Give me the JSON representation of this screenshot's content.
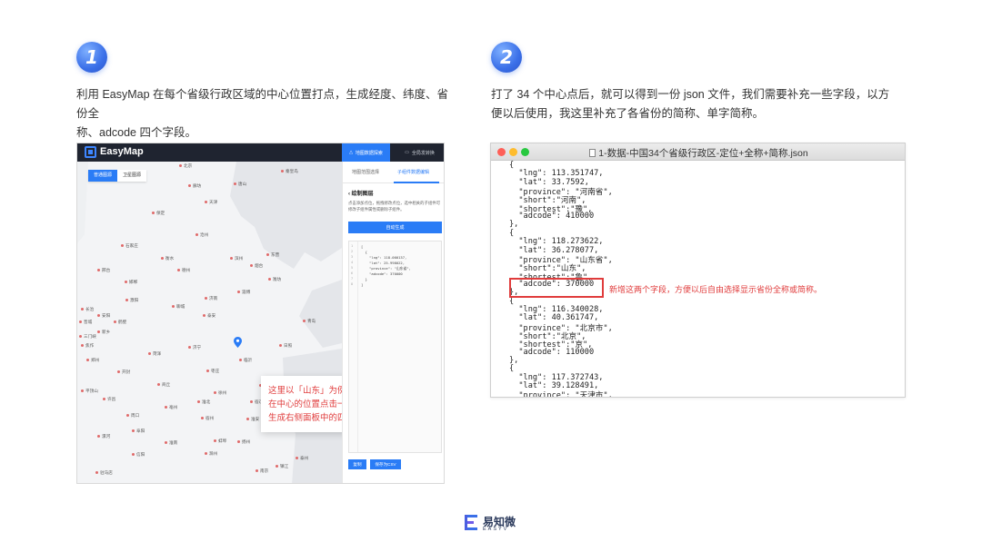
{
  "steps": [
    {
      "number": "1",
      "text_line1": "利用 EasyMap 在每个省级行政区域的中心位置打点，生成经度、纬度、省份全",
      "text_line2": "称、adcode 四个字段。"
    },
    {
      "number": "2",
      "text_line1": "打了 34 个中心点后，就可以得到一份 json 文件，我们需要补充一些字段，以方",
      "text_line2": "便以后使用，我这里补充了各省份的简称、单字简称。"
    }
  ],
  "easymap": {
    "brand": "EasyMap",
    "header_tabs": [
      {
        "label": "地图数据探索",
        "icon": "triangle-icon"
      },
      {
        "label": "全局发转换",
        "icon": "chat-icon"
      }
    ],
    "map_toggle": [
      "普通图源",
      "卫星图源"
    ],
    "cities": [
      {
        "name": "北京"
      },
      {
        "name": "秦皇岛"
      },
      {
        "name": "唐山"
      },
      {
        "name": "廊坊"
      },
      {
        "name": "天津"
      },
      {
        "name": "保定"
      },
      {
        "name": "沧州"
      },
      {
        "name": "石家庄"
      },
      {
        "name": "衡水"
      },
      {
        "name": "东营"
      },
      {
        "name": "邢台"
      },
      {
        "name": "滨州"
      },
      {
        "name": "德州"
      },
      {
        "name": "烟台"
      },
      {
        "name": "潍坊"
      },
      {
        "name": "邯郸"
      },
      {
        "name": "淄博"
      },
      {
        "name": "济南"
      },
      {
        "name": "聊城"
      },
      {
        "name": "濮阳"
      },
      {
        "name": "泰安"
      },
      {
        "name": "新乡"
      },
      {
        "name": "青岛"
      },
      {
        "name": "济宁"
      },
      {
        "name": "日照"
      },
      {
        "name": "菏泽"
      },
      {
        "name": "枣庄"
      },
      {
        "name": "临沂"
      },
      {
        "name": "开封"
      },
      {
        "name": "郑州"
      },
      {
        "name": "商丘"
      },
      {
        "name": "徐州"
      },
      {
        "name": "连云港"
      },
      {
        "name": "宿迁"
      },
      {
        "name": "许昌"
      },
      {
        "name": "亳州"
      },
      {
        "name": "淮北"
      },
      {
        "name": "宿州"
      },
      {
        "name": "淮安"
      },
      {
        "name": "周口"
      },
      {
        "name": "阜阳"
      },
      {
        "name": "蚌埠"
      },
      {
        "name": "盐城"
      },
      {
        "name": "淮南"
      },
      {
        "name": "滁州"
      },
      {
        "name": "扬州"
      },
      {
        "name": "南京"
      },
      {
        "name": "镇江"
      },
      {
        "name": "泰州"
      },
      {
        "name": "安阳"
      },
      {
        "name": "鹤壁"
      },
      {
        "name": "驻马店"
      },
      {
        "name": "信阳"
      },
      {
        "name": "漯河"
      },
      {
        "name": "晋城"
      },
      {
        "name": "长治"
      },
      {
        "name": "平顶山"
      },
      {
        "name": "三门峡"
      },
      {
        "name": "焦作"
      }
    ],
    "callout": "这里以「山东」为例，只需要在中心的位置点击一下，即可生成右侧面板中的四个字段。",
    "panel": {
      "tabs": [
        "地图范围选择",
        "子组件数据编辑"
      ],
      "title": "绘制图层",
      "desc": "点击添加点位，拖拽修改点位，选中相关的子组件可修改子组件属性或删除子组件。",
      "generate_button": "自动生成",
      "code": [
        "[",
        "  {",
        "    \"lng\": 118.000137,",
        "    \"lat\": 25.998022,",
        "    \"province\": \"山东省\",",
        "    \"adcode\": 370000",
        "  }",
        "]"
      ],
      "copy_button": "复制",
      "csv_button": "保存为CSV"
    }
  },
  "json_window": {
    "title": "1-数据-中国34个省级行政区-定位+全称+简称.json",
    "lines": [
      "{",
      "  \"lng\": 113.351747,",
      "  \"lat\": 33.7592,",
      "  \"province\": \"河南省\",",
      "  \"short\":\"河南\",",
      "  \"shortest\":\"豫\",",
      "  \"adcode\": 410000",
      "},",
      "{",
      "  \"lng\": 118.273622,",
      "  \"lat\": 36.278077,",
      "  \"province\": \"山东省\",",
      "  \"short\":\"山东\",",
      "  \"shortest\":\"鲁\",",
      "  \"adcode\": 370000",
      "},",
      "{",
      "  \"lng\": 116.340028,",
      "  \"lat\": 40.361747,",
      "  \"province\": \"北京市\",",
      "  \"short\":\"北京\",",
      "  \"shortest\":\"京\",",
      "  \"adcode\": 110000",
      "},",
      "{",
      "  \"lng\": 117.372743,",
      "  \"lat\": 39.128491,",
      "  \"province\": \"天津市\","
    ],
    "note": "新增这两个字段，方便以后自由选择显示省份全称或简称。"
  },
  "footer": {
    "brand_cn": "易知微",
    "brand_en": "EASYV"
  },
  "colors": {
    "accent": "#2a7cf6",
    "highlight": "#e03c3c",
    "badge": "#3a6fe8"
  }
}
